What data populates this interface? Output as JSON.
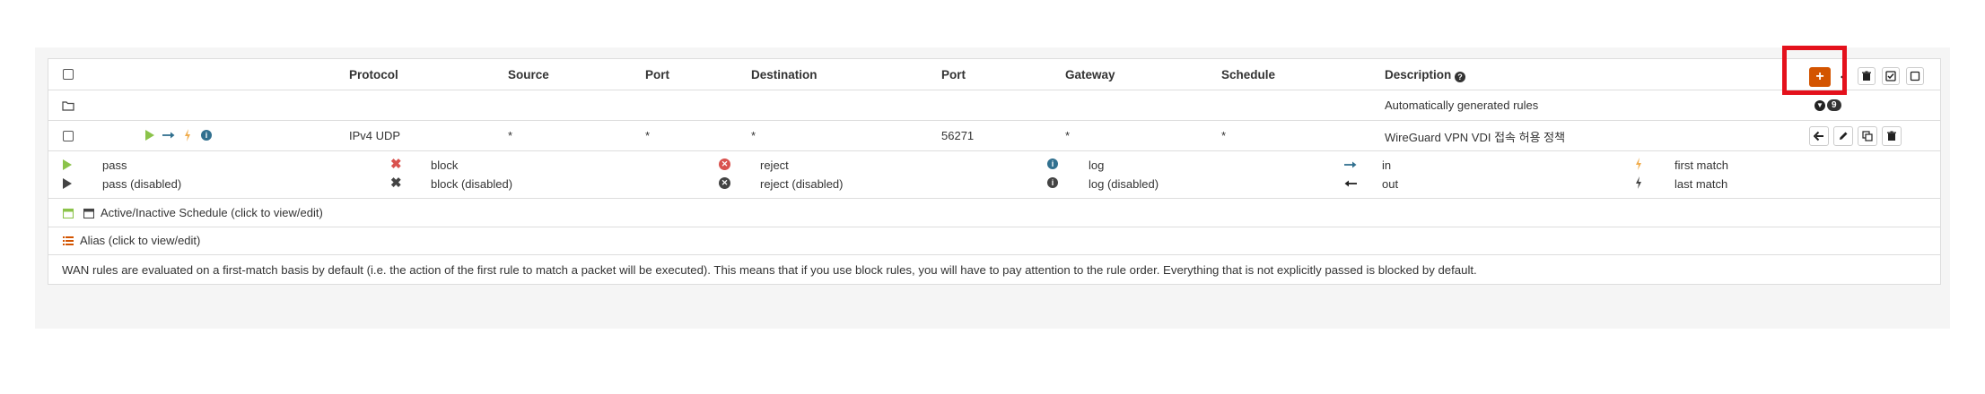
{
  "header": {
    "protocol": "Protocol",
    "source": "Source",
    "port_src": "Port",
    "destination": "Destination",
    "port_dst": "Port",
    "gateway": "Gateway",
    "schedule": "Schedule",
    "description": "Description"
  },
  "auto_row": {
    "label": "Automatically generated rules",
    "count": "9"
  },
  "rule": {
    "protocol": "IPv4 UDP",
    "source": "*",
    "port_src": "*",
    "destination": "*",
    "port_dst": "56271",
    "gateway": "*",
    "schedule": "*",
    "description": "WireGuard VPN VDI 접속 허용 정책"
  },
  "legend": {
    "pass": "pass",
    "pass_disabled": "pass (disabled)",
    "block": "block",
    "block_disabled": "block (disabled)",
    "reject": "reject",
    "reject_disabled": "reject (disabled)",
    "log": "log",
    "log_disabled": "log (disabled)",
    "in": "in",
    "out": "out",
    "first_match": "first match",
    "last_match": "last match",
    "schedule_text": "Active/Inactive Schedule (click to view/edit)",
    "alias_text": "Alias (click to view/edit)",
    "note": "WAN rules are evaluated on a first-match basis by default (i.e. the action of the first rule to match a packet will be executed). This means that if you use block rules, you will have to pay attention to the rule order. Everything that is not explicitly passed is blocked by default."
  },
  "colors": {
    "add_button": "#d35400",
    "highlight": "#e4111c",
    "pass": "#8bc34a",
    "block": "#d9534f",
    "info": "#31708f",
    "lightning": "#f0ad4e"
  }
}
